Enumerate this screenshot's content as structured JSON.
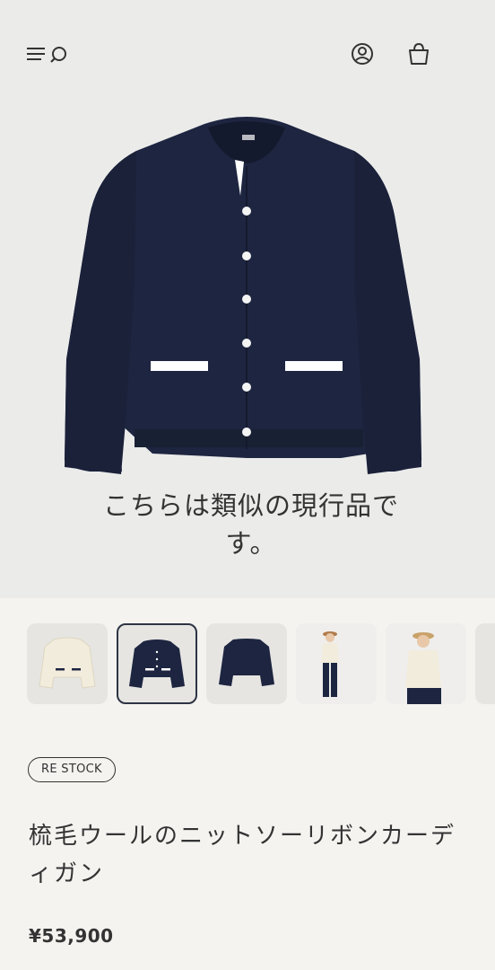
{
  "header": {
    "menu_icon": "menu-icon",
    "search_icon": "search-icon",
    "account_icon": "user-circle-icon",
    "cart_icon": "shopping-bag-icon"
  },
  "hero": {
    "caption": "こちらは類似の現行品です。",
    "jacket_color": "#1d2540"
  },
  "thumbnails": [
    {
      "label": "ivory cardigan",
      "color": "#f1ecdc"
    },
    {
      "label": "navy cardigan",
      "color": "#1d2540",
      "selected": true
    },
    {
      "label": "navy cardigan back",
      "color": "#1d2540"
    },
    {
      "label": "model styling",
      "color": "#f1ecdc"
    },
    {
      "label": "model with hat",
      "color": "#f1ecdc"
    }
  ],
  "product": {
    "badge": "RE STOCK",
    "title": "梳毛ウールのニットソーリボンカーディガン",
    "price": "¥53,900"
  },
  "colors": {
    "background": "#f4f3f0",
    "hero_background": "#ebebea",
    "text": "#333333",
    "navy": "#1d2540"
  }
}
